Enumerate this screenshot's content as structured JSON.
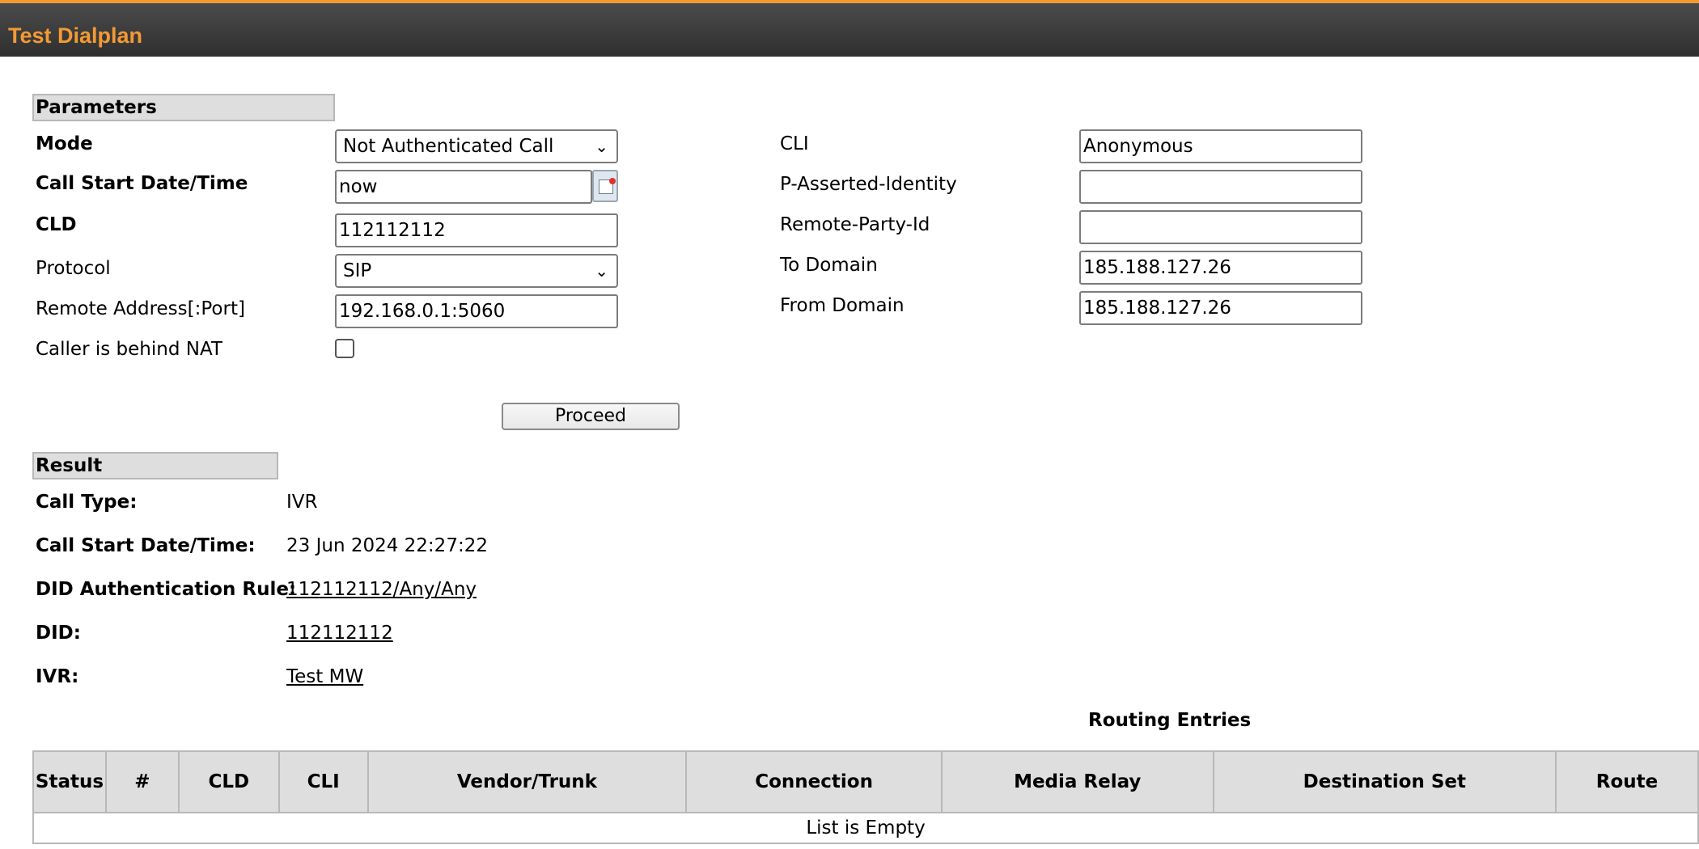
{
  "header": {
    "title": "Test Dialplan"
  },
  "parameters": {
    "section_title": "Parameters",
    "mode": {
      "label": "Mode",
      "value": "Not Authenticated Call"
    },
    "call_start": {
      "label": "Call Start Date/Time",
      "value": "now"
    },
    "cld": {
      "label": "CLD",
      "value": "112112112"
    },
    "protocol": {
      "label": "Protocol",
      "value": "SIP"
    },
    "remote_address": {
      "label": "Remote Address[:Port]",
      "value": "192.168.0.1:5060"
    },
    "behind_nat": {
      "label": "Caller is behind NAT",
      "checked": false
    },
    "cli": {
      "label": "CLI",
      "value": "Anonymous"
    },
    "pai": {
      "label": "P-Asserted-Identity",
      "value": ""
    },
    "rpid": {
      "label": "Remote-Party-Id",
      "value": ""
    },
    "to_domain": {
      "label": "To Domain",
      "value": "185.188.127.26"
    },
    "from_domain": {
      "label": "From Domain",
      "value": "185.188.127.26"
    },
    "proceed_label": "Proceed"
  },
  "result": {
    "section_title": "Result",
    "call_type": {
      "label": "Call Type:",
      "value": "IVR"
    },
    "call_start": {
      "label": "Call Start Date/Time:",
      "value": "23 Jun 2024 22:27:22"
    },
    "did_rule": {
      "label": "DID Authentication Rule:",
      "value": "112112112/Any/Any"
    },
    "did": {
      "label": "DID:",
      "value": "112112112"
    },
    "ivr": {
      "label": "IVR:",
      "value": "Test MW"
    }
  },
  "routing": {
    "title": "Routing Entries",
    "columns": [
      "Status",
      "#",
      "CLD",
      "CLI",
      "Vendor/Trunk",
      "Connection",
      "Media Relay",
      "Destination Set",
      "Route"
    ],
    "empty_text": "List is Empty"
  }
}
